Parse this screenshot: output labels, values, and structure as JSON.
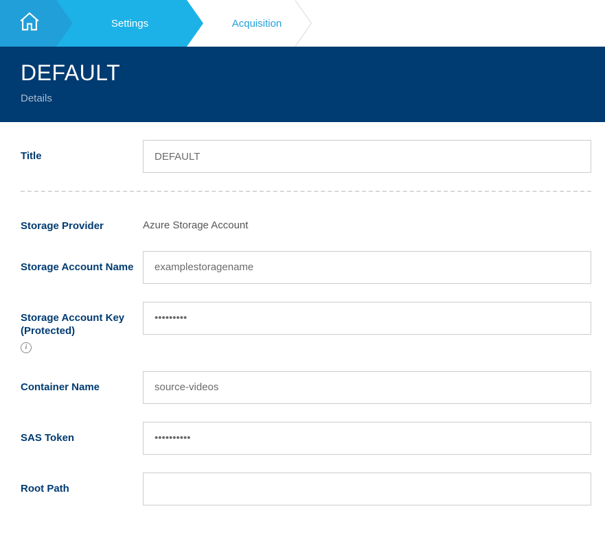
{
  "breadcrumb": {
    "settings": "Settings",
    "acquisition": "Acquisition"
  },
  "header": {
    "title": "DEFAULT",
    "subtitle": "Details"
  },
  "form": {
    "title": {
      "label": "Title",
      "value": "DEFAULT"
    },
    "storage_provider": {
      "label": "Storage Provider",
      "value": "Azure Storage Account"
    },
    "storage_account_name": {
      "label": "Storage Account Name",
      "value": "examplestoragename"
    },
    "storage_account_key": {
      "label": "Storage Account Key (Protected)",
      "value": "•••••••••"
    },
    "container_name": {
      "label": "Container Name",
      "value": "source-videos"
    },
    "sas_token": {
      "label": "SAS Token",
      "value": "••••••••••"
    },
    "root_path": {
      "label": "Root Path",
      "value": ""
    }
  }
}
